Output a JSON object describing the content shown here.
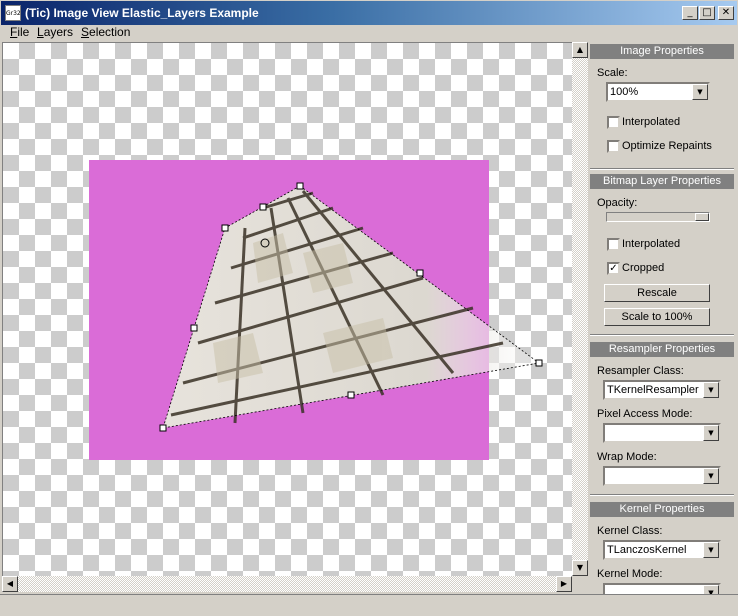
{
  "window": {
    "app_icon_text": "Gr32",
    "title": "(Tic) Image View Elastic_Layers Example",
    "minimize_glyph": "_",
    "maximize_glyph": "□",
    "close_glyph": "✕"
  },
  "menu": {
    "items": [
      {
        "accel": "F",
        "rest": "ile"
      },
      {
        "accel": "L",
        "rest": "ayers"
      },
      {
        "accel": "S",
        "rest": "election"
      }
    ]
  },
  "image_properties": {
    "header": "Image Properties",
    "scale_label": "Scale:",
    "scale_value": "100%",
    "interpolated_label": "Interpolated",
    "interpolated_checked": false,
    "optimize_label": "Optimize Repaints",
    "optimize_checked": false
  },
  "bitmap_layer_properties": {
    "header": "Bitmap Layer Properties",
    "opacity_label": "Opacity:",
    "opacity_fraction": 1.0,
    "interpolated_label": "Interpolated",
    "interpolated_checked": false,
    "cropped_label": "Cropped",
    "cropped_checked": true,
    "rescale_label": "Rescale",
    "scale100_label": "Scale to 100%"
  },
  "resampler_properties": {
    "header": "Resampler Properties",
    "class_label": "Resampler Class:",
    "class_value": "TKernelResampler",
    "pixel_access_label": "Pixel Access Mode:",
    "pixel_access_value": "",
    "wrap_label": "Wrap Mode:",
    "wrap_value": ""
  },
  "kernel_properties": {
    "header": "Kernel Properties",
    "class_label": "Kernel Class:",
    "class_value": "TLanczosKernel",
    "mode_label": "Kernel Mode:"
  },
  "check_glyph": "✓",
  "dropdown_glyph": "▼",
  "colors": {
    "title_gradient_start": "#0a246a",
    "title_gradient_end": "#a6caf0",
    "layer_background": "#da6cd7",
    "group_header": "#808080",
    "face": "#d4d0c8"
  }
}
